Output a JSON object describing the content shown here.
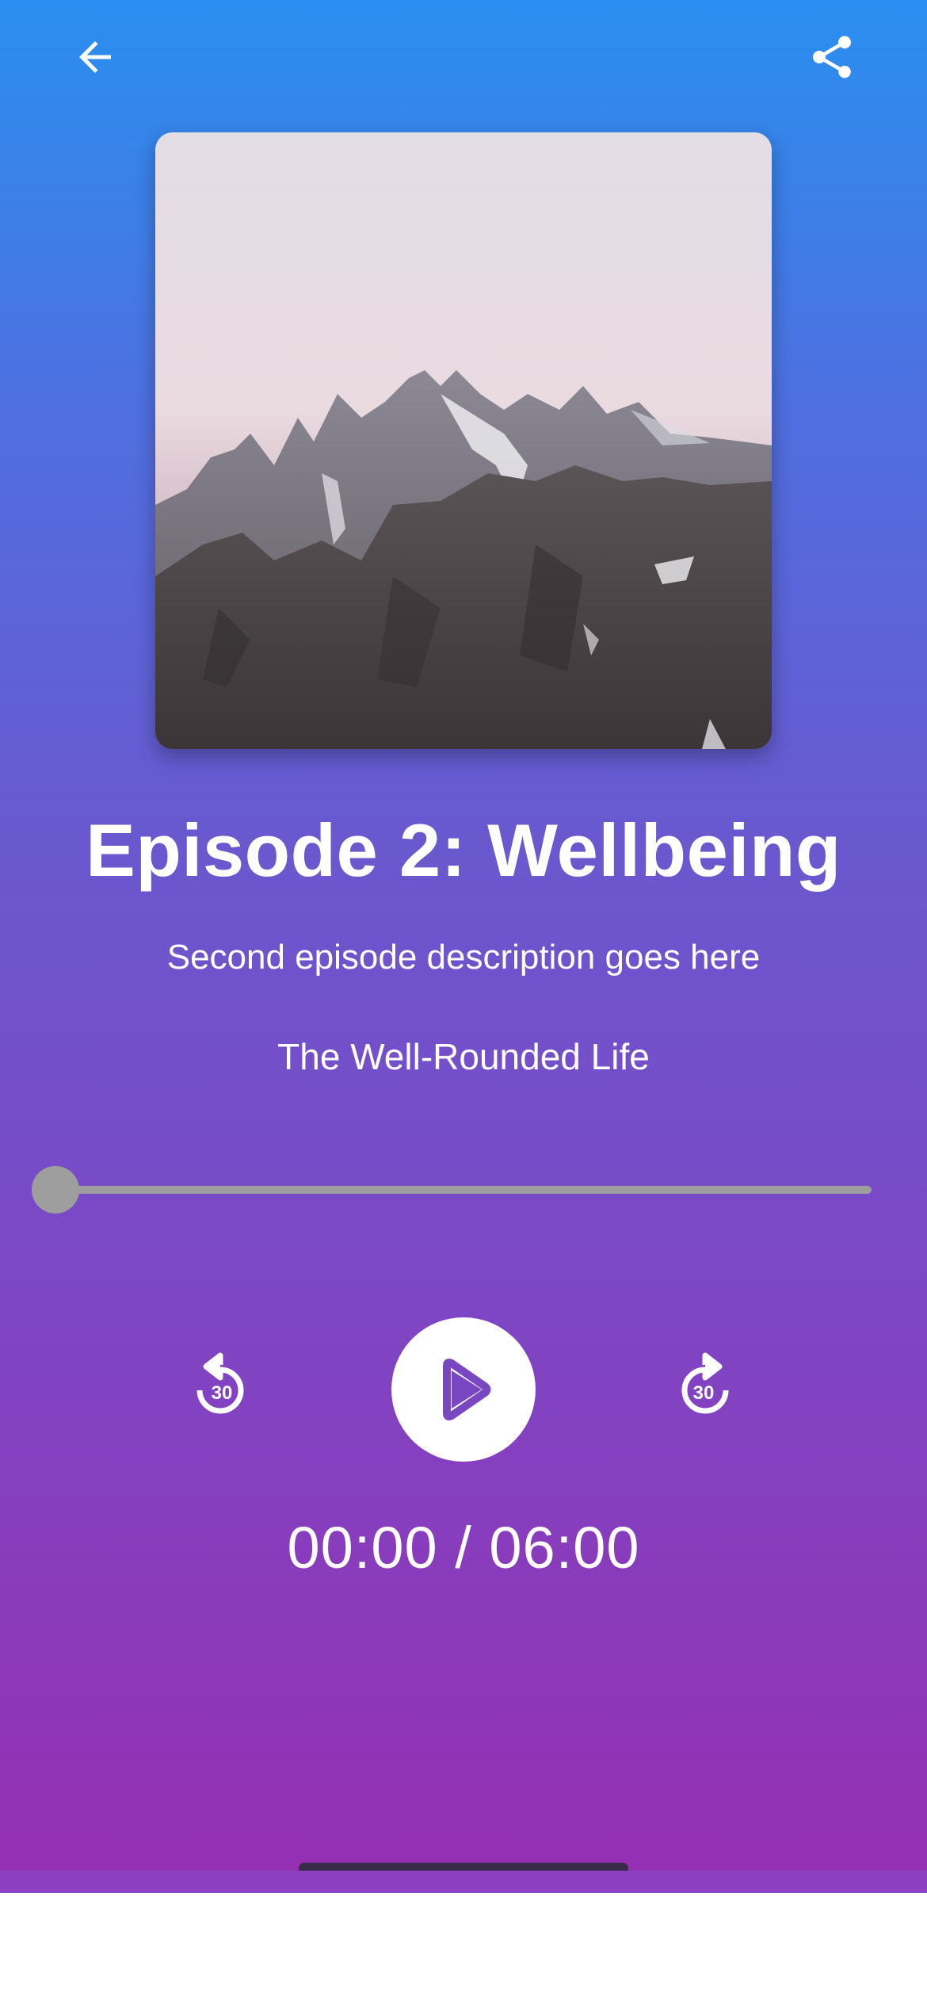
{
  "header": {
    "back_icon": "arrow-left-icon",
    "share_icon": "share-icon"
  },
  "artwork": {
    "description_icon": "episode-artwork"
  },
  "episode": {
    "title": "Episode 2: Wellbeing",
    "description": "Second episode description goes here",
    "podcast_name": "The Well-Rounded Life"
  },
  "player": {
    "progress_fraction": 0,
    "rewind_seconds": "30",
    "forward_seconds": "30",
    "play_icon": "play-icon",
    "time_readout": "00:00 / 06:00"
  },
  "colors": {
    "gradient_top": "#2a8ff0",
    "gradient_bottom": "#9530b3",
    "slider": "#9e9e9e",
    "play_button": "#ffffff",
    "play_glyph": "#7a47c2"
  }
}
